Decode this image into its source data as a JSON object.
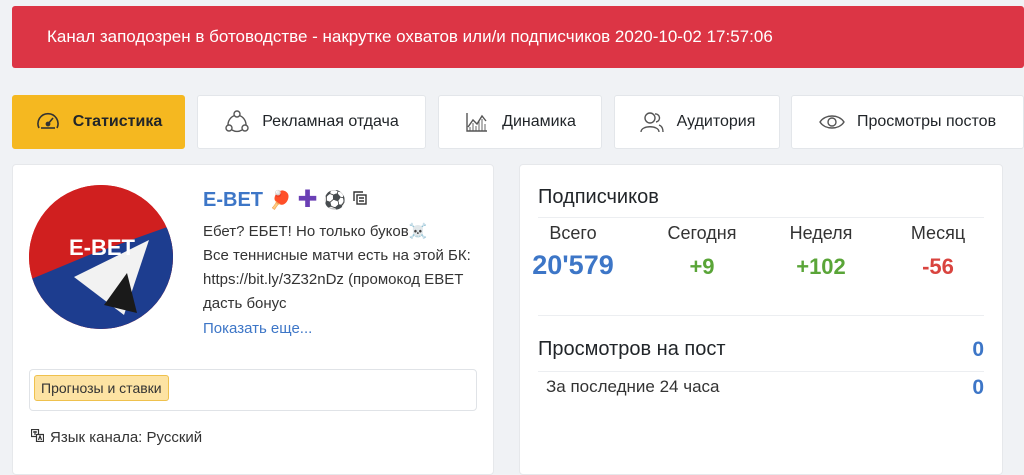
{
  "alert": {
    "text": "Канал заподозрен в ботоводстве - накрутке охватов или/и подписчиков 2020-10-02 17:57:06"
  },
  "tabs": [
    {
      "label": "Статистика",
      "icon": "speedometer-icon",
      "active": true
    },
    {
      "label": "Рекламная отдача",
      "icon": "share-icon",
      "active": false
    },
    {
      "label": "Динамика",
      "icon": "chart-icon",
      "active": false
    },
    {
      "label": "Аудитория",
      "icon": "users-icon",
      "active": false
    },
    {
      "label": "Просмотры постов",
      "icon": "eye-icon",
      "active": false
    }
  ],
  "channel": {
    "avatar_text": "E-BET",
    "name": "E-BET",
    "description": "Ебет? ЕБЕТ! Но только буков☠️\nВсе теннисные матчи есть на этой БК: https://bit.ly/3Z32nDz (промокод EBET дасть бонус",
    "show_more": "Показать еще...",
    "tag": "Прогнозы и ставки",
    "language": "Язык канала: Русский"
  },
  "subscribers": {
    "title": "Подписчиков",
    "columns": [
      {
        "label": "Всего",
        "value": "20'579",
        "color": "#3d76c7"
      },
      {
        "label": "Сегодня",
        "value": "+9",
        "color": "#5aa538"
      },
      {
        "label": "Неделя",
        "value": "+102",
        "color": "#5aa538"
      },
      {
        "label": "Месяц",
        "value": "-56",
        "color": "#d9443f"
      }
    ]
  },
  "views": {
    "title": "Просмотров на пост",
    "title_value": "0",
    "row_label": "За последние 24 часа",
    "row_value": "0"
  },
  "colors": {
    "alert": "#dc3545",
    "accent": "#f5b820",
    "link": "#3d76c7",
    "positive": "#5aa538",
    "negative": "#d9443f"
  }
}
